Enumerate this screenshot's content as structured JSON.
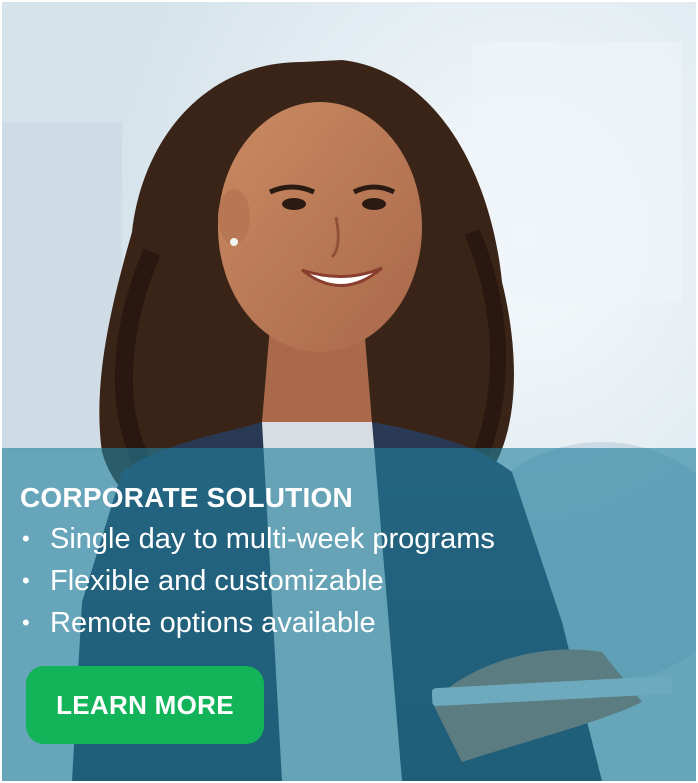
{
  "banner": {
    "headline": "CORPORATE SOLUTION",
    "bullets": [
      "Single day to multi-week programs",
      "Flexible and customizable",
      "Remote options available"
    ],
    "bullet_glyph": "•",
    "cta_label": "LEARN MORE",
    "hero_image": "smiling-woman-photo"
  },
  "colors": {
    "overlay": "#22809c",
    "cta_background": "#13b35a",
    "text": "#ffffff"
  }
}
